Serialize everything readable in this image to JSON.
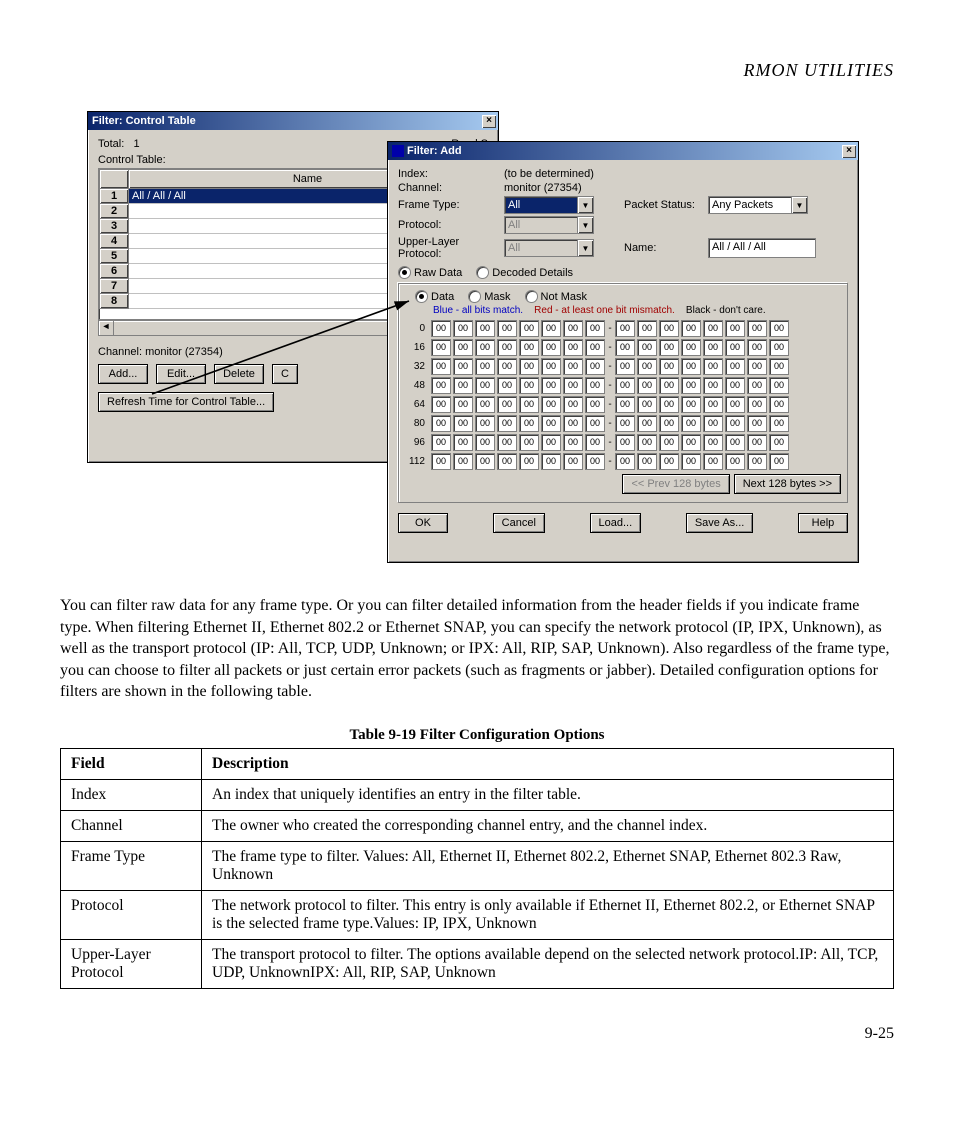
{
  "header": {
    "section": "RMON UTILITIES"
  },
  "win1": {
    "title": "Filter: Control Table",
    "total_label": "Total:",
    "total_value": "1",
    "read_label": "Read S",
    "control_table_label": "Control Table:",
    "col_name": "Name",
    "rows": [
      "1",
      "2",
      "3",
      "4",
      "5",
      "6",
      "7",
      "8"
    ],
    "row1_value": "All / All / All",
    "channel_label": "Channel: monitor (27354)",
    "btn_add": "Add...",
    "btn_edit": "Edit...",
    "btn_delete": "Delete",
    "btn_c": "C",
    "btn_refresh": "Refresh Time for Control Table..."
  },
  "win2": {
    "title": "Filter: Add",
    "index_label": "Index:",
    "index_value": "(to be determined)",
    "channel_label": "Channel:",
    "channel_value": "monitor (27354)",
    "frame_label": "Frame Type:",
    "frame_value": "All",
    "protocol_label": "Protocol:",
    "protocol_value": "All",
    "upper_label": "Upper-Layer Protocol:",
    "upper_value": "All",
    "packet_label": "Packet Status:",
    "packet_value": "Any Packets",
    "name_label": "Name:",
    "name_value": "All / All / All",
    "raw_label": "Raw Data",
    "decoded_label": "Decoded Details",
    "data_label": "Data",
    "mask_label": "Mask",
    "notmask_label": "Not Mask",
    "legend_blue": "Blue - all bits match.",
    "legend_red": "Red - at least one bit mismatch.",
    "legend_black": "Black - don't care.",
    "btn_prev": "<< Prev 128 bytes",
    "btn_next": "Next 128 bytes >>",
    "btn_ok": "OK",
    "btn_cancel": "Cancel",
    "btn_load": "Load...",
    "btn_save": "Save As...",
    "btn_help": "Help"
  },
  "chart_data": {
    "type": "table",
    "description": "Hex byte grid: 8 rows × 16 cells, offsets 0..112 step 16, every cell value '00'",
    "offsets": [
      0,
      16,
      32,
      48,
      64,
      80,
      96,
      112
    ],
    "cells_per_row": 16,
    "cell_value": "00"
  },
  "paragraph": "You can filter raw data for any frame type. Or you can filter detailed information from the header fields if you indicate frame type. When filtering Ethernet II, Ethernet 802.2 or Ethernet SNAP, you can specify the network protocol (IP, IPX, Unknown), as well as the transport protocol (IP: All, TCP, UDP, Unknown; or IPX: All, RIP, SAP, Unknown). Also regardless of the frame type, you can choose to filter all packets or just certain error packets (such as fragments or jabber). Detailed configuration options for filters are shown in the following table.",
  "table_caption": "Table 9-19  Filter Configuration Options",
  "table": {
    "head_field": "Field",
    "head_desc": "Description",
    "rows": [
      {
        "f": "Index",
        "d": "An index that uniquely identifies an entry in the filter table."
      },
      {
        "f": "Channel",
        "d": "The owner who created the corresponding channel entry, and the channel index."
      },
      {
        "f": "Frame Type",
        "d": "The frame type to filter. Values: All, Ethernet II, Ethernet 802.2, Ethernet SNAP, Ethernet 802.3 Raw, Unknown"
      },
      {
        "f": "Protocol",
        "d": "The network protocol to filter. This entry is only available if Ethernet II, Ethernet 802.2, or Ethernet SNAP is the selected frame type.Values: IP, IPX, Unknown"
      },
      {
        "f": "Upper-Layer Protocol",
        "d": "The transport protocol to filter. The options available depend on the selected network protocol.IP: All, TCP, UDP, UnknownIPX: All, RIP, SAP, Unknown"
      }
    ]
  },
  "page_number": "9-25"
}
